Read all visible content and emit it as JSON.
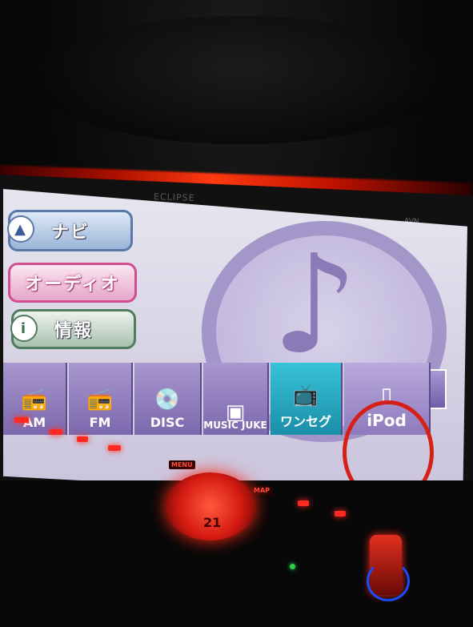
{
  "device": {
    "brand": "ECLIPSE",
    "model": "AVN..."
  },
  "main_menu": {
    "navi": "ナビ",
    "audio": "オーディオ",
    "info": "情報"
  },
  "sources": {
    "am": "AM",
    "fm": "FM",
    "disc": "DISC",
    "music_juke": "MUSIC JUKE",
    "oneseg": "ワンセグ",
    "ipod": "iPod"
  },
  "panel": {
    "menu": "MENU",
    "map": "MAP",
    "temp": "21"
  },
  "colors": {
    "highlight": "#d61f17",
    "accent_tv": "#38c3d8",
    "source_bar": "#8f7bbd"
  }
}
